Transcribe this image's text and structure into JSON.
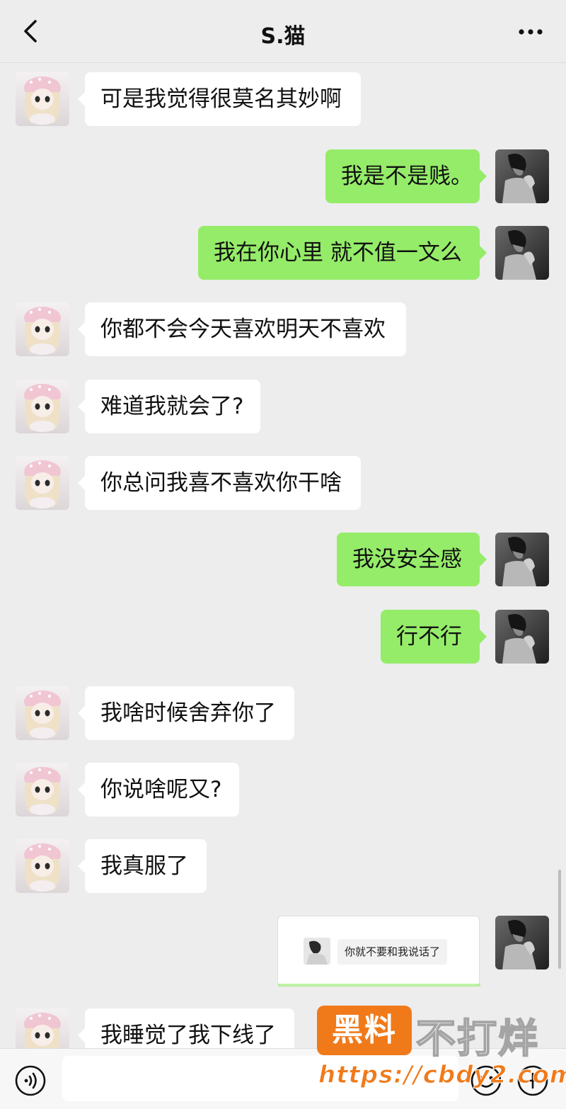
{
  "header": {
    "title": "S.猫",
    "back_icon": "chevron-left-icon",
    "more_icon": "ellipsis-icon"
  },
  "messages": [
    {
      "side": "left",
      "text": "可是我觉得很莫名其妙啊"
    },
    {
      "side": "right",
      "text": "我是不是贱。"
    },
    {
      "side": "right",
      "text": "我在你心里 就不值一文么"
    },
    {
      "side": "left",
      "text": "你都不会今天喜欢明天不喜欢"
    },
    {
      "side": "left",
      "text": "难道我就会了?"
    },
    {
      "side": "left",
      "text": "你总问我喜不喜欢你干啥"
    },
    {
      "side": "right",
      "text": "我没安全感"
    },
    {
      "side": "right",
      "text": "行不行"
    },
    {
      "side": "left",
      "text": "我啥时候舍弃你了"
    },
    {
      "side": "left",
      "text": "你说啥呢又?"
    },
    {
      "side": "left",
      "text": "我真服了"
    },
    {
      "side": "right",
      "type": "image",
      "text": "你就不要和我说话了"
    },
    {
      "side": "left",
      "text": "我睡觉了我下线了"
    }
  ],
  "footer": {
    "voice_icon": "voice-icon",
    "emoji_icon": "emoji-icon",
    "plus_icon": "plus-icon",
    "input_placeholder": ""
  },
  "watermark": {
    "badge": "黑料",
    "text": "不打烊",
    "url": "https://cbdy2.com"
  },
  "colors": {
    "background": "#ededed",
    "bubble_self": "#95ec69",
    "bubble_other": "#ffffff",
    "watermark": "#f07a1a"
  }
}
